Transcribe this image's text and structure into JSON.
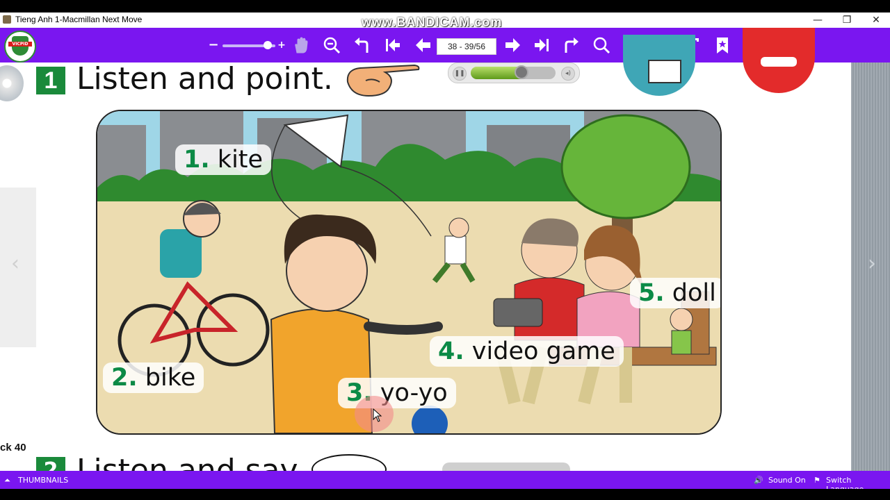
{
  "window": {
    "title": "Tieng Anh 1-Macmillan Next Move",
    "minimize": "—",
    "maximize": "❐",
    "close": "✕"
  },
  "watermark": "www.BANDICAM.com",
  "toolbar": {
    "logo_text": "VICPID",
    "zoom_out_label": "−",
    "zoom_in_label": "+",
    "zoom_level": 0.85,
    "page_field": "38 - 39/56",
    "icons": [
      "hand-icon",
      "zoom-out-icon",
      "undo-icon",
      "first-page-icon",
      "prev-page-icon",
      "next-page-icon",
      "last-page-icon",
      "redo-icon",
      "search-icon",
      "help-icon",
      "fullscreen-icon",
      "text-icon",
      "bookmark-icon"
    ],
    "accent": "#7a16f0"
  },
  "page": {
    "section1": {
      "number": "1",
      "title": "Listen and point."
    },
    "audio_progress": 0.6,
    "labels": [
      {
        "num": "1.",
        "word": "kite"
      },
      {
        "num": "2.",
        "word": "bike"
      },
      {
        "num": "3.",
        "word": "yo-yo"
      },
      {
        "num": "4.",
        "word": "video game"
      },
      {
        "num": "5.",
        "word": "doll"
      }
    ],
    "track_label": "ck 40",
    "section2": {
      "number": "2",
      "title": "Listen and say."
    }
  },
  "statusbar": {
    "thumbnails": "THUMBNAILS",
    "sound": "Sound On",
    "language": "Switch Language"
  }
}
